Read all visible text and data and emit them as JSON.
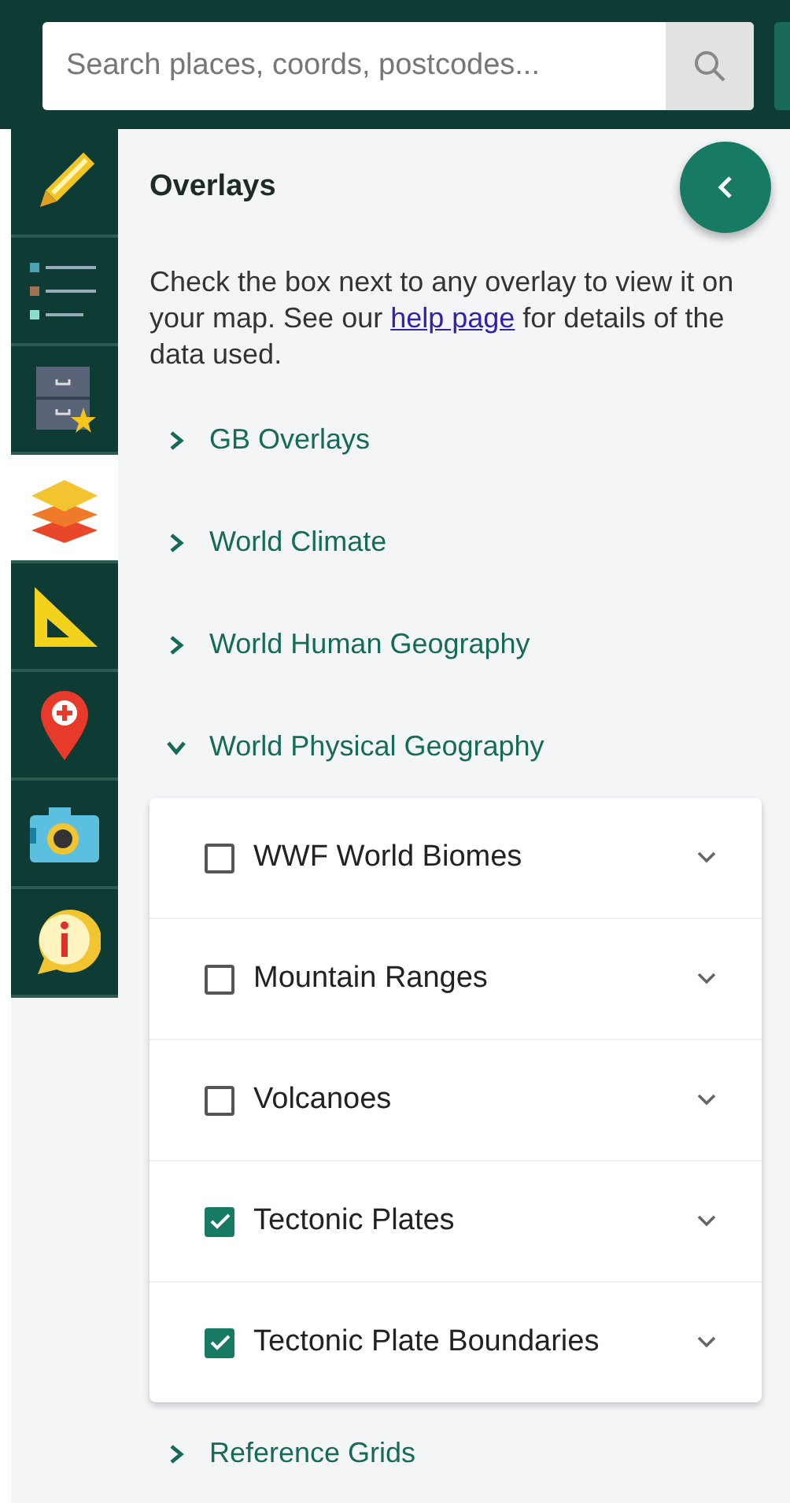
{
  "search": {
    "placeholder": "Search places, coords, postcodes..."
  },
  "toolbar": {
    "tools": [
      {
        "kind": "pencil",
        "selected": false
      },
      {
        "kind": "legend",
        "selected": false
      },
      {
        "kind": "saved",
        "selected": false
      },
      {
        "kind": "layers",
        "selected": true
      },
      {
        "kind": "measure",
        "selected": false
      },
      {
        "kind": "pin",
        "selected": false
      },
      {
        "kind": "camera",
        "selected": false
      },
      {
        "kind": "info",
        "selected": false
      }
    ]
  },
  "panel": {
    "title": "Overlays",
    "description": {
      "before": "Check the box next to any overlay to view it on your map. See our ",
      "link": "help page",
      "after": " for details of the data used."
    },
    "sections": [
      {
        "label": "GB Overlays",
        "expanded": false
      },
      {
        "label": "World Climate",
        "expanded": false
      },
      {
        "label": "World Human Geography",
        "expanded": false
      },
      {
        "label": "World Physical Geography",
        "expanded": true,
        "items": [
          {
            "label": "WWF World Biomes",
            "checked": false
          },
          {
            "label": "Mountain Ranges",
            "checked": false
          },
          {
            "label": "Volcanoes",
            "checked": false
          },
          {
            "label": "Tectonic Plates",
            "checked": true
          },
          {
            "label": "Tectonic Plate Boundaries",
            "checked": true
          }
        ]
      },
      {
        "label": "Reference Grids",
        "expanded": false
      }
    ]
  }
}
